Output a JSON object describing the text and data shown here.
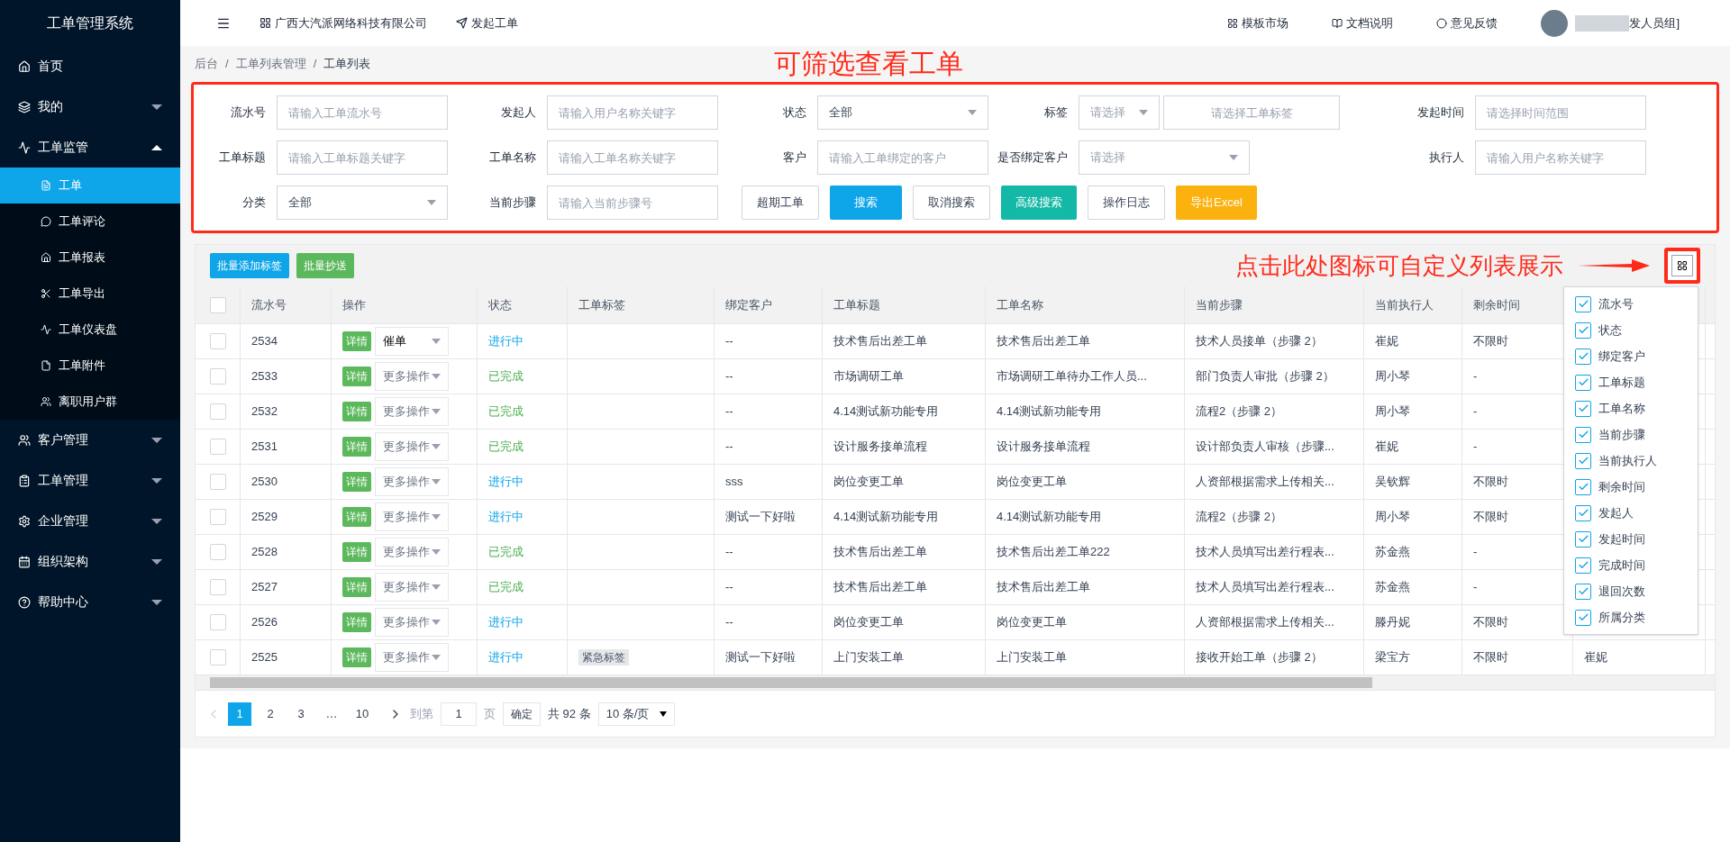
{
  "sidebar": {
    "title": "工单管理系统",
    "items": [
      {
        "label": "首页",
        "selected": false
      },
      {
        "label": "我的",
        "selected": false,
        "expanded": false
      },
      {
        "label": "工单监管",
        "selected": false,
        "expanded": true,
        "children": [
          {
            "label": "工单",
            "selected": true
          },
          {
            "label": "工单评论",
            "selected": false
          },
          {
            "label": "工单报表",
            "selected": false
          },
          {
            "label": "工单导出",
            "selected": false
          },
          {
            "label": "工单仪表盘",
            "selected": false
          },
          {
            "label": "工单附件",
            "selected": false
          },
          {
            "label": "离职用户群",
            "selected": false
          }
        ]
      },
      {
        "label": "客户管理",
        "selected": false,
        "expanded": false
      },
      {
        "label": "工单管理",
        "selected": false,
        "expanded": false
      },
      {
        "label": "企业管理",
        "selected": false,
        "expanded": false
      },
      {
        "label": "组织架构",
        "selected": false,
        "expanded": false
      },
      {
        "label": "帮助中心",
        "selected": false,
        "expanded": false
      }
    ]
  },
  "header": {
    "company": "广西大汽派网络科技有限公司",
    "new_ticket": "发起工单",
    "links": [
      "模板市场",
      "文档说明",
      "意见反馈"
    ],
    "user": "发人员组]"
  },
  "breadcrumb": {
    "separator": "/",
    "items": [
      "后台",
      "工单列表管理",
      "工单列表"
    ]
  },
  "annotations": [
    "可筛选查看工单",
    "点击此处图标可自定义列表展示"
  ],
  "filters": {
    "rows": [
      [
        {
          "label": "流水号",
          "kind": "input",
          "placeholder": "请输入工单流水号"
        },
        {
          "label": "发起人",
          "kind": "input",
          "placeholder": "请输入用户名称关键字"
        },
        {
          "label": "状态",
          "kind": "select",
          "value": "全部"
        },
        {
          "label": "标签",
          "kind": "tag_select",
          "select_placeholder": "请选择",
          "placeholder": "请选择工单标签"
        },
        {
          "label": "发起时间",
          "kind": "input",
          "placeholder": "请选择时间范围"
        }
      ],
      [
        {
          "label": "工单标题",
          "kind": "input",
          "placeholder": "请输入工单标题关键字"
        },
        {
          "label": "工单名称",
          "kind": "input",
          "placeholder": "请输入工单名称关键字"
        },
        {
          "label": "客户",
          "kind": "input",
          "placeholder": "请输入工单绑定的客户"
        },
        {
          "label": "是否绑定客户",
          "kind": "select",
          "placeholder": "请选择"
        },
        {
          "label": "执行人",
          "kind": "input",
          "placeholder": "请输入用户名称关键字"
        }
      ],
      [
        {
          "label": "分类",
          "kind": "select",
          "value": "全部"
        },
        {
          "label": "当前步骤",
          "kind": "input",
          "placeholder": "请输入当前步骤号"
        }
      ]
    ],
    "buttons": [
      {
        "label": "超期工单",
        "kind": "outline"
      },
      {
        "label": "搜索",
        "kind": "primary"
      },
      {
        "label": "取消搜索",
        "kind": "outline"
      },
      {
        "label": "高级搜索",
        "kind": "teal"
      },
      {
        "label": "操作日志",
        "kind": "outline"
      },
      {
        "label": "导出Excel",
        "kind": "warning"
      }
    ]
  },
  "toolbar": [
    {
      "label": "批量添加标签",
      "kind": "primary"
    },
    {
      "label": "批量抄送",
      "kind": "success"
    }
  ],
  "table": {
    "select_all_checked": false,
    "columns": [
      "流水号",
      "操作",
      "状态",
      "工单标签",
      "绑定客户",
      "工单标题",
      "工单名称",
      "当前步骤",
      "当前执行人",
      "剩余时间"
    ],
    "rows": [
      {
        "checked": false,
        "id": "2534",
        "detail": "详情",
        "action": {
          "value": "催单"
        },
        "status": "进行中",
        "completed": false,
        "customer": "--",
        "title": "技术售后出差工单",
        "name": "技术售后出差工单",
        "step": "技术人员接单（步骤 2）",
        "executor": "崔妮",
        "remaining": "不限时"
      },
      {
        "checked": false,
        "id": "2533",
        "detail": "详情",
        "action": {
          "placeholder": "更多操作"
        },
        "status": "已完成",
        "completed": true,
        "customer": "--",
        "title": "市场调研工单",
        "name": "市场调研工单待办工作人员...",
        "step": "部门负责人审批（步骤 2）",
        "executor": "周小琴",
        "remaining": "-"
      },
      {
        "checked": false,
        "id": "2532",
        "detail": "详情",
        "action": {
          "placeholder": "更多操作"
        },
        "status": "已完成",
        "completed": true,
        "customer": "--",
        "title": "4.14测试新功能专用",
        "name": "4.14测试新功能专用",
        "step": "流程2（步骤 2）",
        "executor": "周小琴",
        "remaining": "-"
      },
      {
        "checked": false,
        "id": "2531",
        "detail": "详情",
        "action": {
          "placeholder": "更多操作"
        },
        "status": "已完成",
        "completed": true,
        "customer": "--",
        "title": "设计服务接单流程",
        "name": "设计服务接单流程",
        "step": "设计部负责人审核（步骤...",
        "executor": "崔妮",
        "remaining": "-"
      },
      {
        "checked": false,
        "id": "2530",
        "detail": "详情",
        "action": {
          "placeholder": "更多操作"
        },
        "status": "进行中",
        "completed": false,
        "customer": "sss",
        "title": "岗位变更工单",
        "name": "岗位变更工单",
        "step": "人资部根据需求上传相关...",
        "executor": "吴钦辉",
        "remaining": "不限时"
      },
      {
        "checked": false,
        "id": "2529",
        "detail": "详情",
        "action": {
          "placeholder": "更多操作"
        },
        "status": "进行中",
        "completed": false,
        "customer": "测试一下好啦",
        "title": "4.14测试新功能专用",
        "name": "4.14测试新功能专用",
        "step": "流程2（步骤 2）",
        "executor": "周小琴",
        "remaining": "不限时"
      },
      {
        "checked": false,
        "id": "2528",
        "detail": "详情",
        "action": {
          "placeholder": "更多操作"
        },
        "status": "已完成",
        "completed": true,
        "customer": "--",
        "title": "技术售后出差工单",
        "name": "技术售后出差工单222",
        "step": "技术人员填写出差行程表...",
        "executor": "苏金燕",
        "remaining": "-"
      },
      {
        "checked": false,
        "id": "2527",
        "detail": "详情",
        "action": {
          "placeholder": "更多操作"
        },
        "status": "已完成",
        "completed": true,
        "customer": "--",
        "title": "技术售后出差工单",
        "name": "技术售后出差工单",
        "step": "技术人员填写出差行程表...",
        "executor": "苏金燕",
        "remaining": "-"
      },
      {
        "checked": false,
        "id": "2526",
        "detail": "详情",
        "action": {
          "placeholder": "更多操作"
        },
        "status": "进行中",
        "completed": false,
        "customer": "--",
        "title": "岗位变更工单",
        "name": "岗位变更工单",
        "step": "人资部根据需求上传相关...",
        "executor": "滕丹妮",
        "remaining": "不限时"
      },
      {
        "checked": false,
        "id": "2525",
        "detail": "详情",
        "action": {
          "placeholder": "更多操作"
        },
        "status": "进行中",
        "completed": false,
        "tag": "紧急标签",
        "customer": "测试一下好啦",
        "title": "上门安装工单",
        "name": "上门安装工单",
        "step": "接收开始工单（步骤 2）",
        "executor": "梁宝方",
        "remaining": "不限时",
        "column_12": "崔妮"
      }
    ]
  },
  "column_picker": [
    {
      "label": "流水号",
      "checked": true
    },
    {
      "label": "状态",
      "checked": true
    },
    {
      "label": "绑定客户",
      "checked": true
    },
    {
      "label": "工单标题",
      "checked": true
    },
    {
      "label": "工单名称",
      "checked": true
    },
    {
      "label": "当前步骤",
      "checked": true
    },
    {
      "label": "当前执行人",
      "checked": true
    },
    {
      "label": "剩余时间",
      "checked": true
    },
    {
      "label": "发起人",
      "checked": true
    },
    {
      "label": "发起时间",
      "checked": true
    },
    {
      "label": "完成时间",
      "checked": true
    },
    {
      "label": "退回次数",
      "checked": true
    },
    {
      "label": "所属分类",
      "checked": true
    }
  ],
  "pagination": {
    "pages": [
      {
        "label": "1",
        "selected": true
      },
      {
        "label": "2",
        "selected": false
      },
      {
        "label": "3",
        "selected": false
      },
      {
        "label": "…",
        "selected": false
      },
      {
        "label": "10",
        "selected": false
      }
    ],
    "goto": "到第",
    "page_value": "1",
    "page_unit": "页",
    "confirm": "确定",
    "total": "共 92 条",
    "page_size": "10 条/页"
  }
}
